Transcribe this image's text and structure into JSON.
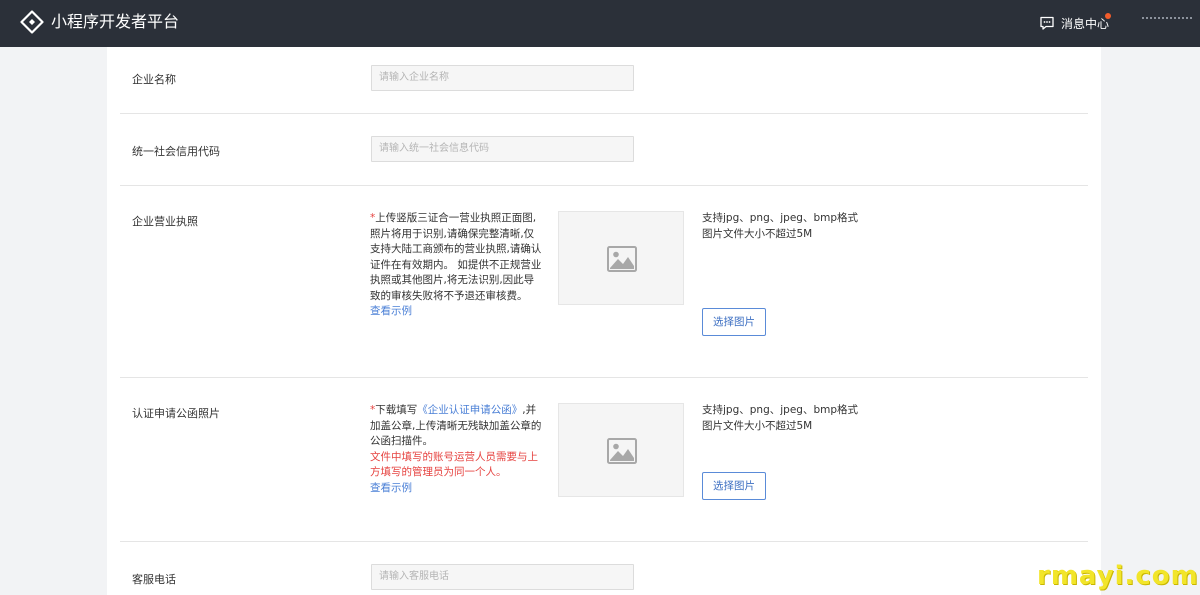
{
  "header": {
    "brand_title": "小程序开发者平台",
    "message_center": "消息中心",
    "accent_dot_color": "#f25c2b"
  },
  "form": {
    "company_name": {
      "label": "企业名称",
      "placeholder": "请输入企业名称"
    },
    "credit_code": {
      "label": "统一社会信用代码",
      "placeholder": "请输入统一社会信息代码"
    },
    "business_license": {
      "label": "企业营业执照",
      "required_mark": "*",
      "description": "上传竖版三证合一营业执照正面图,照片将用于识别,请确保完整清晰,仅支持大陆工商颁布的营业执照,请确认证件在有效期内。 如提供不正规营业执照或其他图片,将无法识别,因此导致的审核失败将不予退还审核费。",
      "example_link": "查看示例",
      "format_hint": "支持jpg、png、jpeg、bmp格式",
      "size_hint": "图片文件大小不超过5M",
      "choose_button": "选择图片"
    },
    "authorization_letter": {
      "label": "认证申请公函照片",
      "required_mark": "*",
      "desc_prefix": "下载填写",
      "desc_link": "《企业认证申请公函》",
      "desc_suffix": ",并加盖公章,上传清晰无残缺加盖公章的公函扫描件。",
      "warning": "文件中填写的账号运营人员需要与上方填写的管理员为同一个人。",
      "example_link": "查看示例",
      "format_hint": "支持jpg、png、jpeg、bmp格式",
      "size_hint": "图片文件大小不超过5M",
      "choose_button": "选择图片"
    },
    "service_phone": {
      "label": "客服电话",
      "placeholder": "请输入客服电话"
    }
  },
  "watermark": "rmayi.com"
}
